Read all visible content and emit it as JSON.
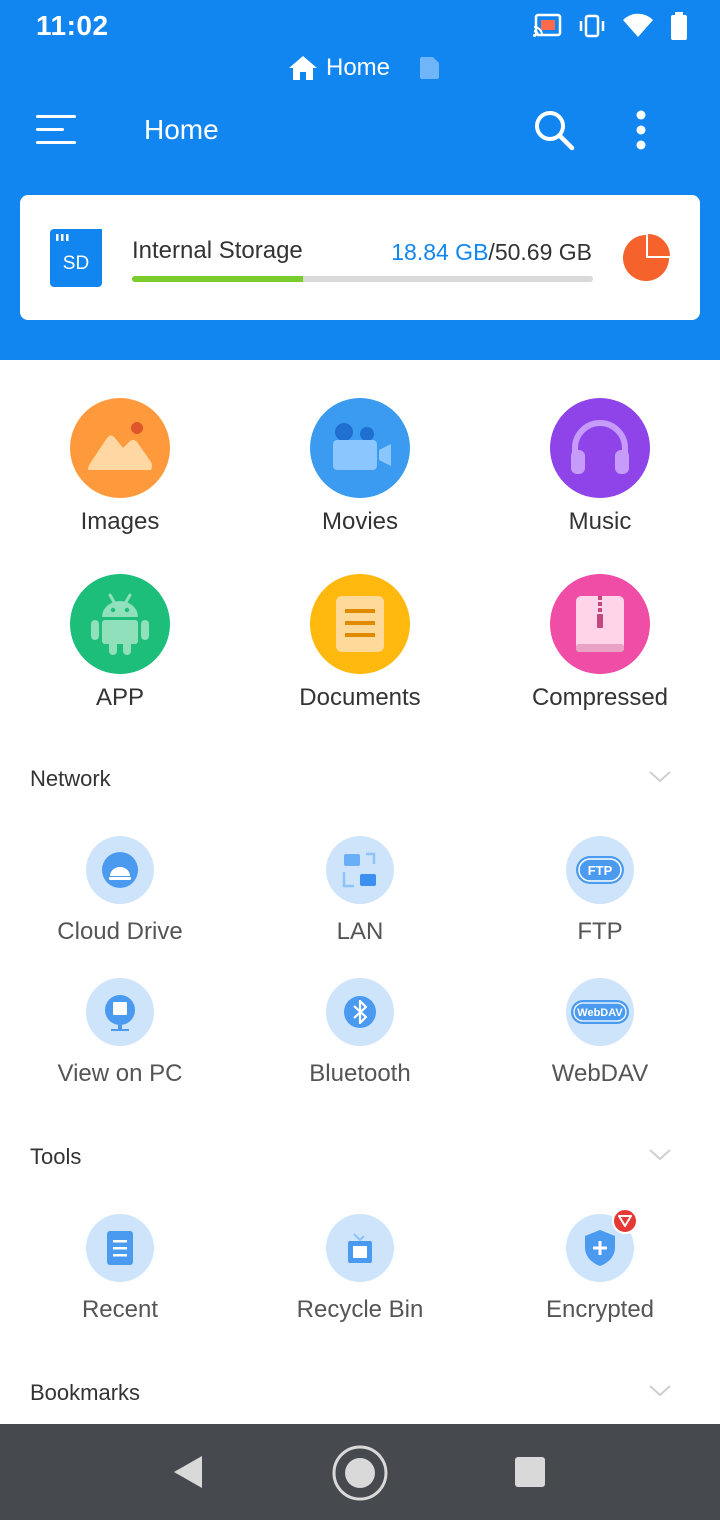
{
  "status_bar": {
    "time": "11:02",
    "icons": [
      "cast-icon",
      "vibrate-icon",
      "wifi-icon",
      "battery-icon"
    ]
  },
  "breadcrumb": {
    "label": "Home",
    "icon": "home-icon"
  },
  "toolbar": {
    "title": "Home",
    "icons": [
      "menu-icon",
      "search-icon",
      "more-vert-icon"
    ]
  },
  "storage": {
    "name": "Internal Storage",
    "used": "18.84 GB",
    "separator": "/",
    "total": "50.69 GB",
    "used_fraction": 0.372
  },
  "categories": [
    {
      "label": "Images",
      "icon": "image-icon",
      "color": "#FF9A3C"
    },
    {
      "label": "Movies",
      "icon": "video-camera-icon",
      "color": "#3A9BF0"
    },
    {
      "label": "Music",
      "icon": "headphones-icon",
      "color": "#8E44E8"
    },
    {
      "label": "APP",
      "icon": "android-icon",
      "color": "#1DBE7A"
    },
    {
      "label": "Documents",
      "icon": "document-icon",
      "color": "#FFB80D"
    },
    {
      "label": "Compressed",
      "icon": "archive-icon",
      "color": "#F04DA6"
    }
  ],
  "network": {
    "title": "Network",
    "items": [
      {
        "label": "Cloud Drive",
        "icon": "cloud-drive-icon"
      },
      {
        "label": "LAN",
        "icon": "lan-icon"
      },
      {
        "label": "FTP",
        "icon": "ftp-icon"
      },
      {
        "label": "View on PC",
        "icon": "view-on-pc-icon"
      },
      {
        "label": "Bluetooth",
        "icon": "bluetooth-icon"
      },
      {
        "label": "WebDAV",
        "icon": "webdav-icon"
      }
    ]
  },
  "tools": {
    "title": "Tools",
    "items": [
      {
        "label": "Recent",
        "icon": "recent-icon"
      },
      {
        "label": "Recycle Bin",
        "icon": "recycle-bin-icon"
      },
      {
        "label": "Encrypted",
        "icon": "encrypted-icon"
      }
    ]
  },
  "bookmarks": {
    "title": "Bookmarks"
  },
  "icon_labels": {
    "sd": "SD",
    "ftp": "FTP",
    "webdav": "WebDAV"
  },
  "colors": {
    "primary": "#1286F0",
    "storage_bar": "#7ACC2A",
    "pie": "#F5622B",
    "tool_circle": "#CDE4FA",
    "nav_bar": "#464A4F"
  }
}
